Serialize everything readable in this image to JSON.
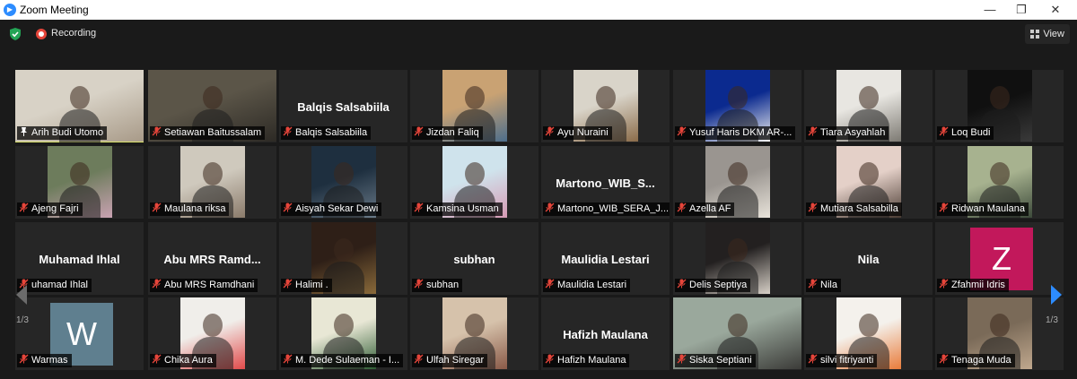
{
  "window": {
    "title": "Zoom Meeting",
    "minimize": "—",
    "maximize": "❐",
    "close": "✕"
  },
  "toolbar": {
    "recording_label": "Recording",
    "view_label": "View"
  },
  "pagination": {
    "left": "1/3",
    "right": "1/3"
  },
  "colors": {
    "active_speaker": "#d9e26a",
    "muted": "#e5453a",
    "accent": "#2d8cff"
  },
  "participants": [
    {
      "name": "Arih Budi Utomo",
      "display": "video",
      "icon": "pin-icon"
    },
    {
      "name": "Setiawan Baitussalam",
      "display": "video"
    },
    {
      "name": "Balqis Salsabiila",
      "display": "name",
      "big": "Balqis Salsabiila"
    },
    {
      "name": "Jizdan Faliq",
      "display": "video"
    },
    {
      "name": "Ayu Nuraini",
      "display": "video"
    },
    {
      "name": "Yusuf Haris DKM AR-...",
      "display": "video"
    },
    {
      "name": "Tiara Asyahlah",
      "display": "video"
    },
    {
      "name": "Loq Budi",
      "display": "video"
    },
    {
      "name": "Ajeng Fajri",
      "display": "video"
    },
    {
      "name": "Maulana riksa",
      "display": "video"
    },
    {
      "name": "Aisyah Sekar Dewi",
      "display": "video"
    },
    {
      "name": "Kamsina Usman",
      "display": "video"
    },
    {
      "name": "Martono_WIB_SERA_J...",
      "display": "name",
      "big": "Martono_WIB_S..."
    },
    {
      "name": "Azella AF",
      "display": "video"
    },
    {
      "name": "Mutiara Salsabilla",
      "display": "video"
    },
    {
      "name": "Ridwan Maulana",
      "display": "video"
    },
    {
      "name": "uhamad Ihlal",
      "display": "name",
      "big": "Muhamad Ihlal"
    },
    {
      "name": "Abu MRS Ramdhani",
      "display": "name",
      "big": "Abu MRS Ramd..."
    },
    {
      "name": "Halimi .",
      "display": "video"
    },
    {
      "name": "subhan",
      "display": "name",
      "big": "subhan"
    },
    {
      "name": "Maulidia Lestari",
      "display": "name",
      "big": "Maulidia Lestari"
    },
    {
      "name": "Delis Septiya",
      "display": "video"
    },
    {
      "name": "Nila",
      "display": "name",
      "big": "Nila"
    },
    {
      "name": "Zfahmii Idris",
      "display": "avatar",
      "avatar_letter": "Z",
      "avatar_color": "#c2185b"
    },
    {
      "name": "Warmas",
      "display": "avatar",
      "avatar_letter": "W",
      "avatar_color": "#5f7f8f"
    },
    {
      "name": "Chika Aura",
      "display": "video"
    },
    {
      "name": "M. Dede Sulaeman - I...",
      "display": "video"
    },
    {
      "name": "Ulfah Siregar",
      "display": "video"
    },
    {
      "name": "Hafizh Maulana",
      "display": "name",
      "big": "Hafizh Maulana"
    },
    {
      "name": "Siska Septiani",
      "display": "video"
    },
    {
      "name": "silvi fitriyanti",
      "display": "video"
    },
    {
      "name": "Tenaga Muda",
      "display": "video"
    }
  ]
}
